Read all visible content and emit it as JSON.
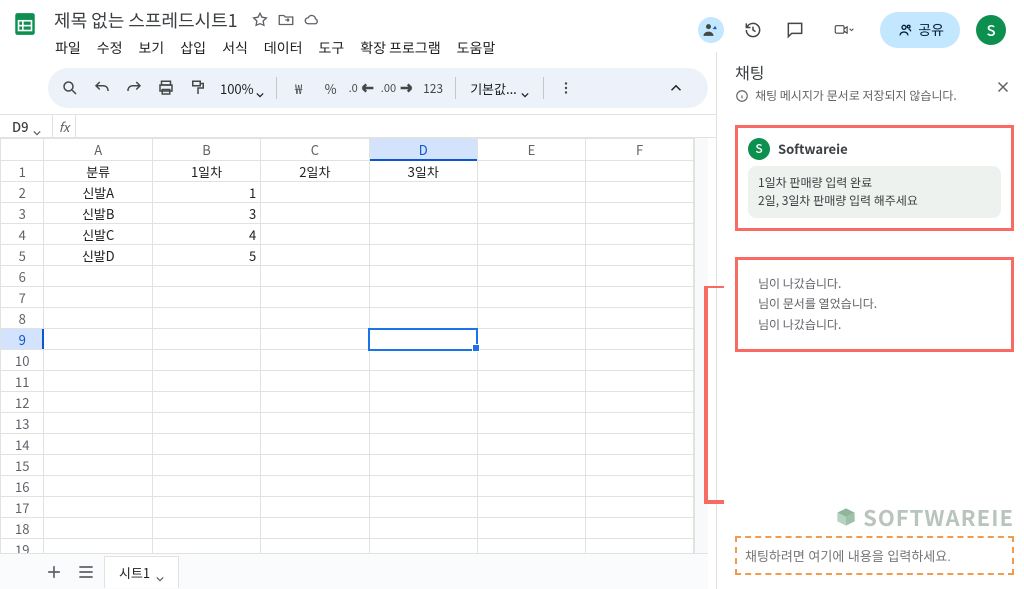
{
  "header": {
    "doc_title": "제목 없는 스프레드시트1",
    "menus": [
      "파일",
      "수정",
      "보기",
      "삽입",
      "서식",
      "데이터",
      "도구",
      "확장 프로그램",
      "도움말"
    ],
    "share_label": "공유",
    "avatar_letter": "S"
  },
  "toolbar": {
    "zoom": "100%",
    "currency": "₩",
    "percent": "%",
    "dec_dec": ".0",
    "dec_inc": ".00",
    "num123": "123",
    "font": "기본값..."
  },
  "formula_bar": {
    "active_cell": "D9",
    "fx_label": "fx",
    "formula": ""
  },
  "grid": {
    "col_labels": [
      "A",
      "B",
      "C",
      "D",
      "E",
      "F"
    ],
    "selected_col_index": 3,
    "selected_row_index": 9,
    "row_count": 19,
    "header_row": [
      "분류",
      "1일차",
      "2일차",
      "3일차",
      "",
      ""
    ],
    "data_rows": [
      [
        "신발A",
        "1",
        "",
        "",
        "",
        ""
      ],
      [
        "신발B",
        "3",
        "",
        "",
        "",
        ""
      ],
      [
        "신발C",
        "4",
        "",
        "",
        "",
        ""
      ],
      [
        "신발D",
        "5",
        "",
        "",
        "",
        ""
      ]
    ]
  },
  "tabs": {
    "add_tip": "+",
    "list_tip": "≡",
    "sheet1": "시트1"
  },
  "chat": {
    "title": "채팅",
    "notice": "채팅 메시지가 문서로 저장되지 않습니다.",
    "msg_user": "Softwareie",
    "msg_avatar": "S",
    "msg_line1": "1일차 판매량 입력 완료",
    "msg_line2": "2일, 3일차 판매량 입력 해주세요",
    "sys1": "님이 나갔습니다.",
    "sys2": "님이 문서를 열었습니다.",
    "sys3": "님이 나갔습니다.",
    "input_placeholder": "채팅하려면 여기에 내용을 입력하세요."
  },
  "watermark": "SOFTWAREIE"
}
